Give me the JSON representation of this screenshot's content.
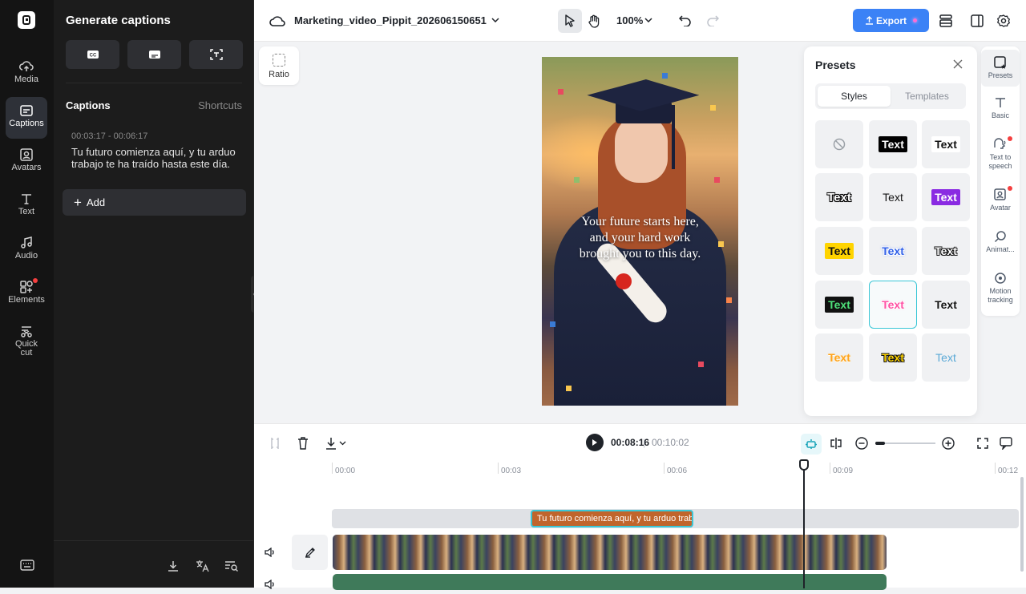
{
  "rail": {
    "items": [
      {
        "label": "Media",
        "icon": "cloud-upload-icon"
      },
      {
        "label": "Captions",
        "icon": "captions-icon",
        "active": true
      },
      {
        "label": "Avatars",
        "icon": "avatar-icon"
      },
      {
        "label": "Text",
        "icon": "text-icon"
      },
      {
        "label": "Audio",
        "icon": "music-note-icon"
      },
      {
        "label": "Elements",
        "icon": "elements-icon",
        "badge": true
      },
      {
        "label": "Quick cut",
        "icon": "quick-cut-icon"
      }
    ],
    "bottom_icon": "keyboard-icon"
  },
  "panel": {
    "title": "Generate captions",
    "gen_buttons": [
      "cc-icon",
      "subtitle-icon",
      "scan-text-icon"
    ],
    "captions_heading": "Captions",
    "shortcuts_label": "Shortcuts",
    "caption": {
      "time": "00:03:17 - 00:06:17",
      "text": "Tu futuro comienza aquí, y tu arduo trabajo te ha traído hasta este día."
    },
    "add_label": "Add",
    "bottom_icons": [
      "download-icon",
      "translate-icon",
      "search-list-icon"
    ]
  },
  "topbar": {
    "project_title": "Marketing_video_Pippit_202606150651",
    "zoom": "100%",
    "export_label": "Export",
    "accent": "#3b82f6"
  },
  "canvas": {
    "ratio_label": "Ratio",
    "video_subtitle": "Your future starts here, and your hard work brought you to this day."
  },
  "presets": {
    "title": "Presets",
    "tabs": [
      "Styles",
      "Templates"
    ],
    "active_tab": "Styles",
    "tile_text": "Text"
  },
  "right_rail": {
    "items": [
      {
        "label": "Presets",
        "active": true
      },
      {
        "label": "Basic"
      },
      {
        "label": "Text to speech",
        "badge": true
      },
      {
        "label": "Avatar",
        "badge": true
      },
      {
        "label": "Animat..."
      },
      {
        "label": "Motion tracking"
      }
    ]
  },
  "timeline": {
    "current_time": "00:08:16",
    "separator": "|",
    "total_time": "00:10:02",
    "ruler": [
      "00:00",
      "00:03",
      "00:06",
      "00:09",
      "00:12"
    ],
    "caption_clip": "Tu futuro comienza aquí, y tu arduo trab"
  }
}
